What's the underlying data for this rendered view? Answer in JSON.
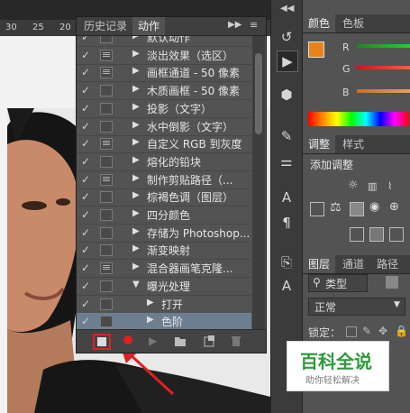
{
  "ruler": {
    "ticks": [
      "30",
      "25",
      "20"
    ]
  },
  "panel": {
    "tabs": [
      "历史记录",
      "动作"
    ],
    "active_tab": "动作",
    "rows": [
      {
        "check": "✓",
        "dialog": false,
        "triangle": "▶",
        "indent": 0,
        "label": "默认动作"
      },
      {
        "check": "✓",
        "dialog": true,
        "triangle": "▶",
        "indent": 0,
        "label": "淡出效果（选区）"
      },
      {
        "check": "✓",
        "dialog": true,
        "triangle": "▶",
        "indent": 0,
        "label": "画框通道 - 50 像素"
      },
      {
        "check": "✓",
        "dialog": false,
        "triangle": "▶",
        "indent": 0,
        "label": "木质画框 - 50 像素"
      },
      {
        "check": "✓",
        "dialog": false,
        "triangle": "▶",
        "indent": 0,
        "label": "投影（文字）"
      },
      {
        "check": "✓",
        "dialog": false,
        "triangle": "▶",
        "indent": 0,
        "label": "水中倒影（文字）"
      },
      {
        "check": "✓",
        "dialog": true,
        "triangle": "▶",
        "indent": 0,
        "label": "自定义 RGB 到灰度"
      },
      {
        "check": "✓",
        "dialog": false,
        "triangle": "▶",
        "indent": 0,
        "label": "熔化的铅块"
      },
      {
        "check": "✓",
        "dialog": true,
        "triangle": "▶",
        "indent": 0,
        "label": "制作剪贴路径（..."
      },
      {
        "check": "✓",
        "dialog": false,
        "triangle": "▶",
        "indent": 0,
        "label": "棕褐色调（图层）"
      },
      {
        "check": "✓",
        "dialog": false,
        "triangle": "▶",
        "indent": 0,
        "label": "四分颜色"
      },
      {
        "check": "✓",
        "dialog": false,
        "triangle": "▶",
        "indent": 0,
        "label": "存储为 Photoshop..."
      },
      {
        "check": "✓",
        "dialog": false,
        "triangle": "▶",
        "indent": 0,
        "label": "渐变映射"
      },
      {
        "check": "✓",
        "dialog": true,
        "triangle": "▶",
        "indent": 0,
        "label": "混合器画笔克隆..."
      },
      {
        "check": "✓",
        "dialog": false,
        "triangle": "▼",
        "indent": 0,
        "label": "曝光处理"
      },
      {
        "check": "✓",
        "dialog": false,
        "triangle": "▶",
        "indent": 1,
        "label": "打开"
      },
      {
        "check": "✓",
        "dialog": false,
        "triangle": "▶",
        "indent": 1,
        "label": "色阶"
      }
    ],
    "selected_row_index": 16
  },
  "color_panel": {
    "tabs": [
      "颜色",
      "色板"
    ],
    "channels": [
      "R",
      "G",
      "B"
    ],
    "foreground_color": "#e9821c"
  },
  "adjust_panel": {
    "tabs": [
      "调整",
      "样式"
    ],
    "title": "添加调整"
  },
  "layers_panel": {
    "tabs": [
      "图层",
      "通道",
      "路径"
    ],
    "filter_label": "类型",
    "blend_mode": "正常",
    "lock_label": "锁定："
  },
  "watermark": {
    "title": "百科全说",
    "subtitle": "助你轻松解决"
  },
  "colors": {
    "accent_red": "#e02020",
    "selection_blue": "#6e7e91"
  }
}
